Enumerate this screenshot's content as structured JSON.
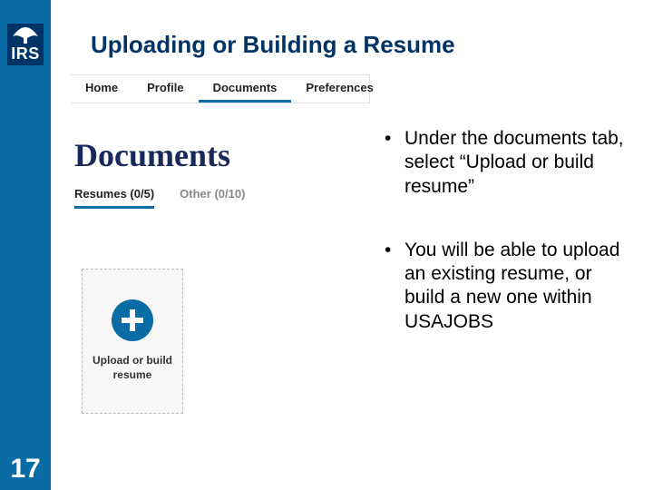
{
  "logo_text": "IRS",
  "title": "Uploading or Building a Resume",
  "nav": {
    "items": [
      {
        "label": "Home"
      },
      {
        "label": "Profile"
      },
      {
        "label": "Documents"
      },
      {
        "label": "Preferences"
      }
    ],
    "active_index": 2
  },
  "doc_heading": "Documents",
  "subtabs": {
    "items": [
      {
        "label": "Resumes (0/5)"
      },
      {
        "label": "Other (0/10)"
      }
    ],
    "active_index": 0
  },
  "upload_card_label": "Upload or build resume",
  "bullets": [
    "Under the documents tab, select “Upload or build resume”",
    "You will be able to upload an existing resume, or build a new one within USAJOBS"
  ],
  "page_number": "17"
}
